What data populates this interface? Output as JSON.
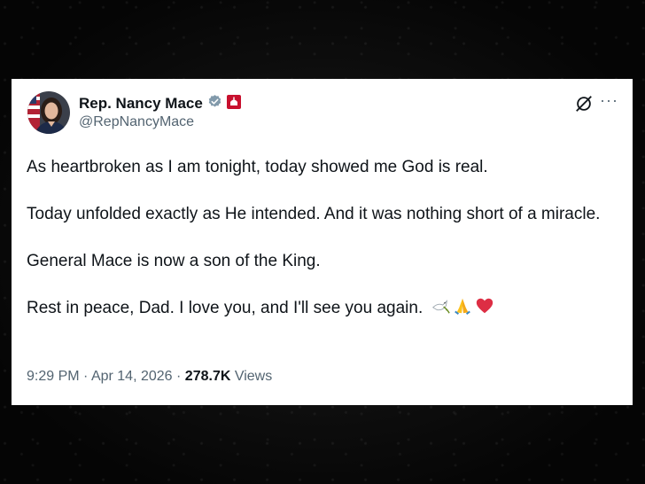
{
  "tweet": {
    "display_name": "Rep. Nancy Mace",
    "handle": "@RepNancyMace",
    "paragraphs": [
      "As heartbroken as I am tonight, today showed me God is real.",
      "Today unfolded exactly as He intended. And it was nothing short of a miracle.",
      "General Mace is now a son of the King.",
      "Rest in peace, Dad. I love you, and I'll see you again."
    ],
    "emoji_icons": [
      "dove-icon",
      "praying-hands-icon",
      "red-heart-icon"
    ],
    "time": "9:29 PM",
    "separator": "·",
    "date": "Apr 14, 2026",
    "views_count": "278.7K",
    "views_label": "Views"
  },
  "colors": {
    "verified_badge": "#829aab",
    "affiliation_badge": "#c8102e",
    "text_primary": "#0f1419",
    "text_secondary": "#536471"
  }
}
